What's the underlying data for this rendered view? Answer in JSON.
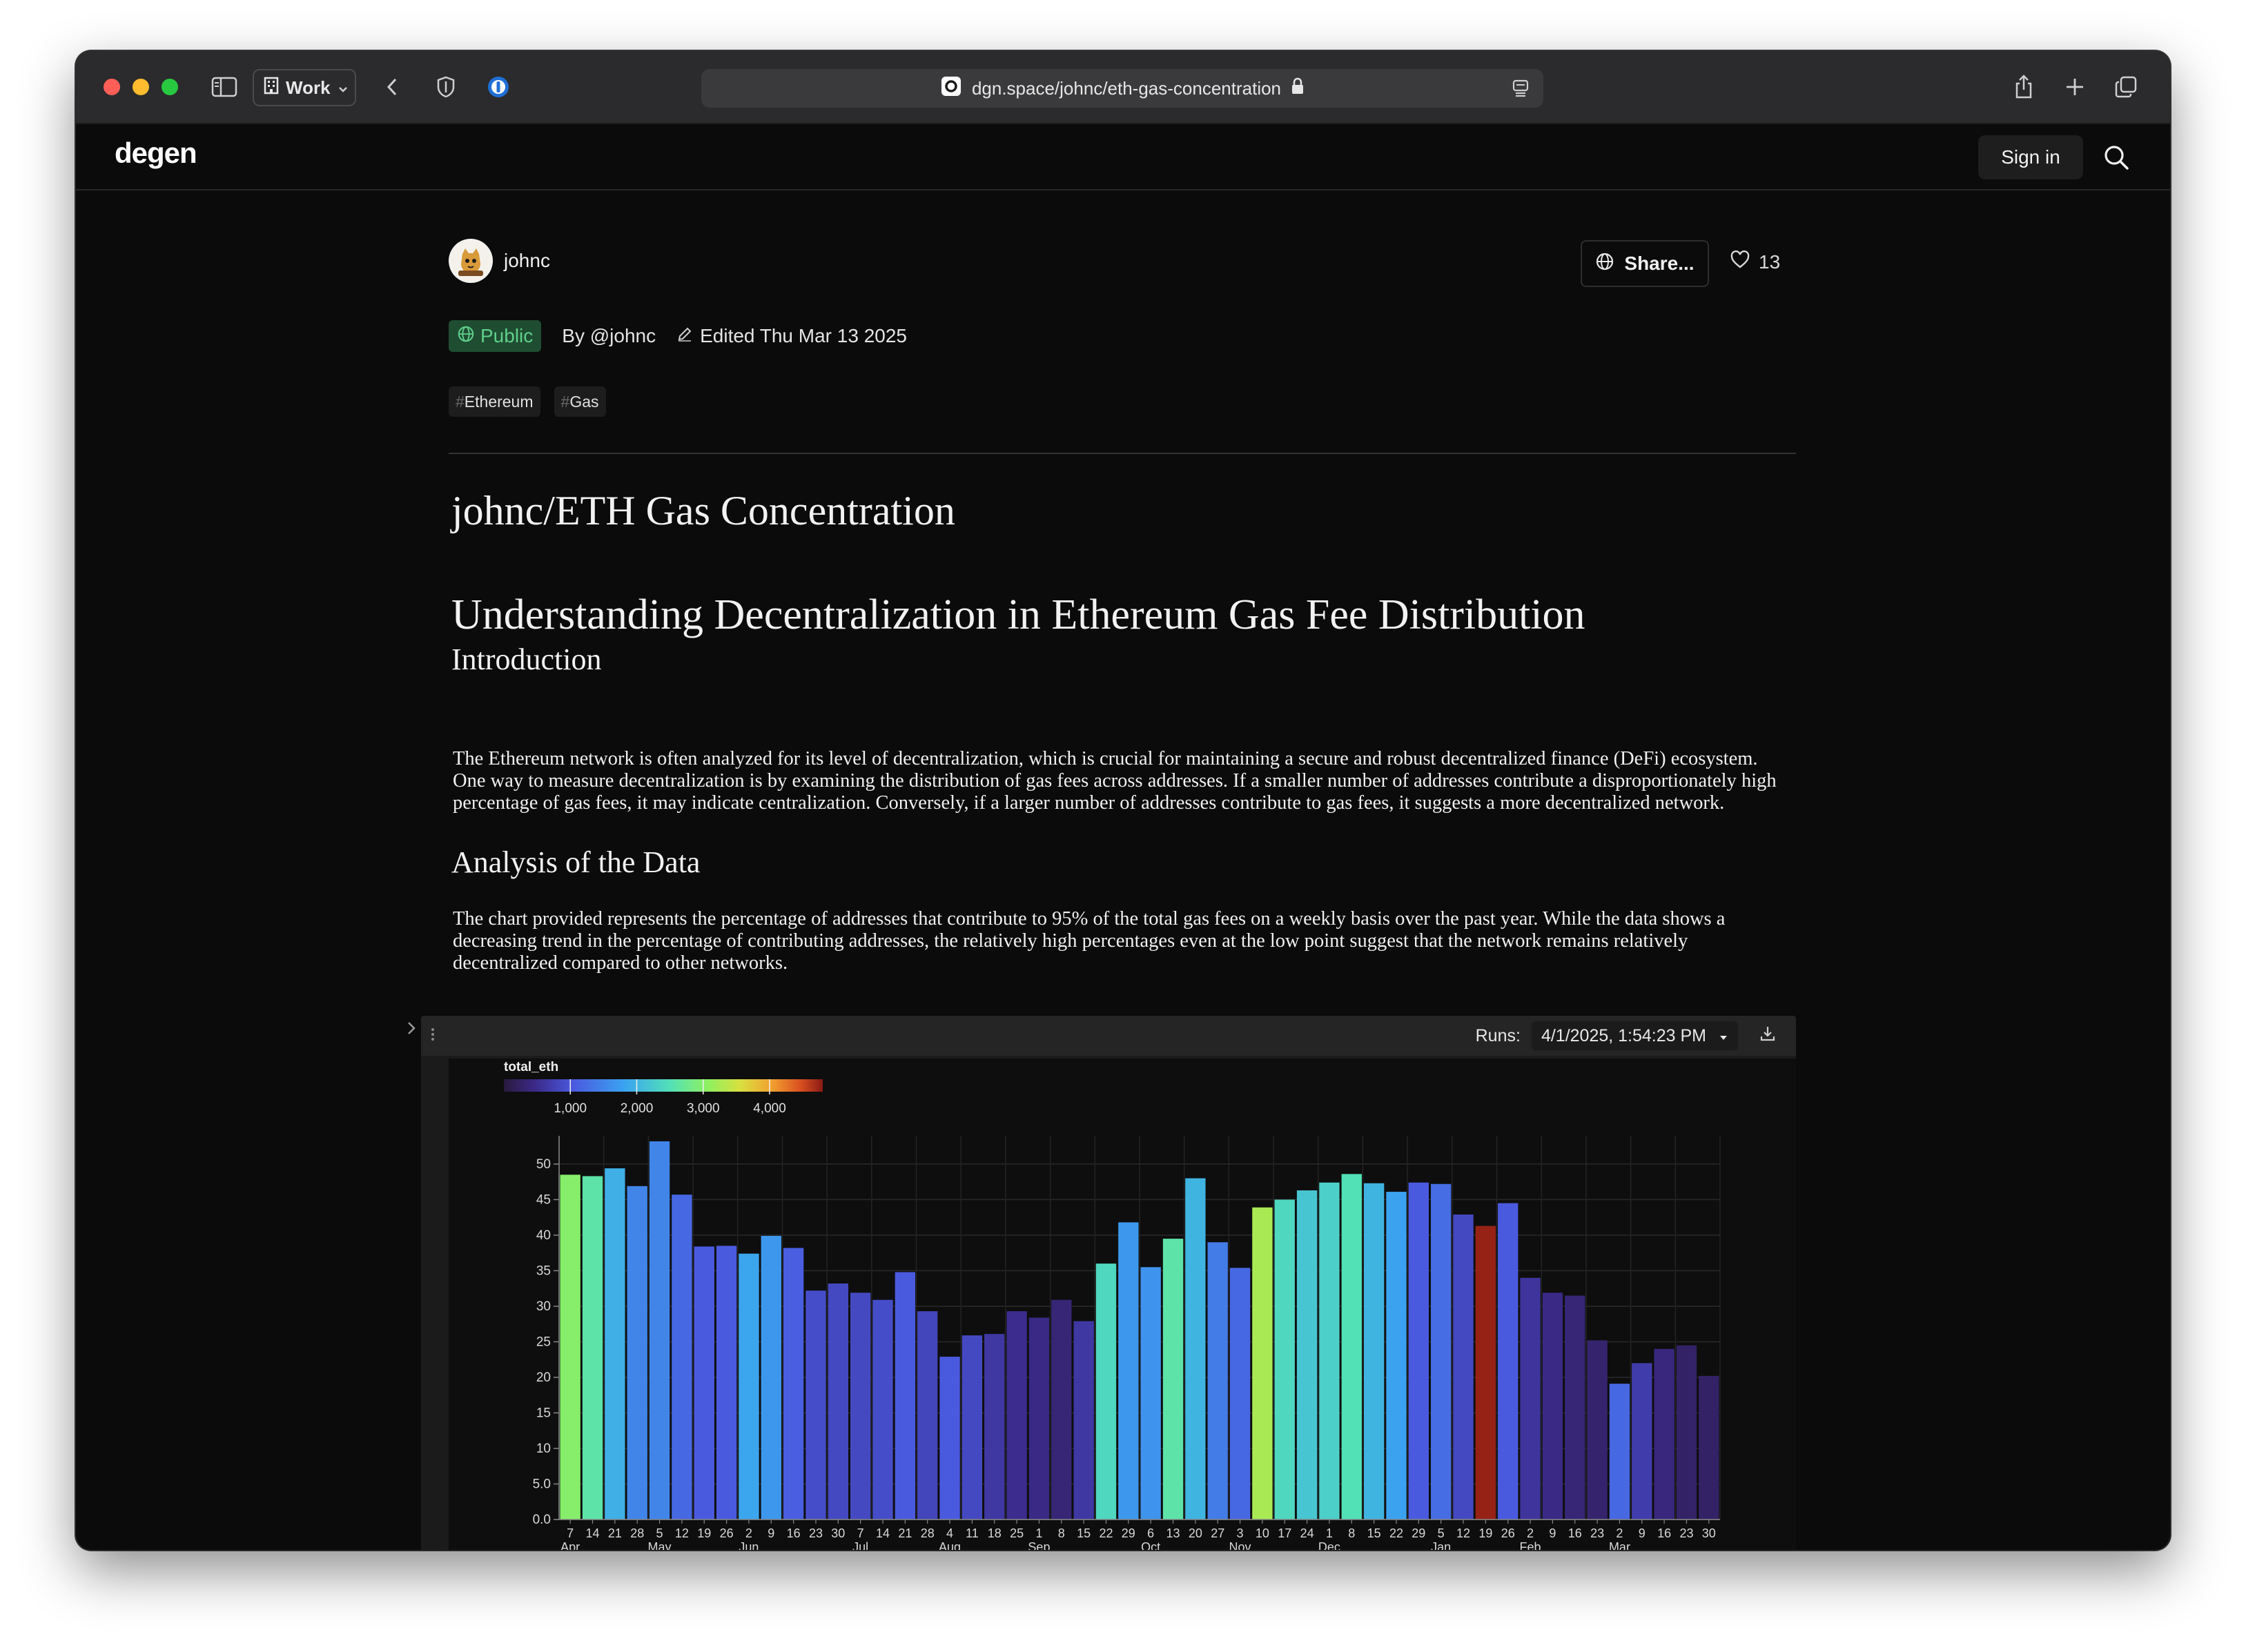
{
  "browser": {
    "tab_group": "Work",
    "url": "dgn.space/johnc/eth-gas-concentration"
  },
  "app": {
    "logo": "degen",
    "sign_in": "Sign in"
  },
  "post": {
    "author": "johnc",
    "share_label": "Share...",
    "likes": "13",
    "visibility": "Public",
    "by": "By @johnc",
    "edited": "Edited Thu Mar 13 2025",
    "tags": [
      {
        "hash": "#",
        "label": "Ethereum"
      },
      {
        "hash": "#",
        "label": "Gas"
      }
    ]
  },
  "doc": {
    "title": "johnc/ETH Gas Concentration",
    "h1": "Understanding Decentralization in Ethereum Gas Fee Distribution",
    "intro_heading": "Introduction",
    "intro_text": "The Ethereum network is often analyzed for its level of decentralization, which is crucial for maintaining a secure and robust decentralized finance (DeFi) ecosystem. One way to measure decentralization is by examining the distribution of gas fees across addresses. If a smaller number of addresses contribute a disproportionately high percentage of gas fees, it may indicate centralization. Conversely, if a larger number of addresses contribute to gas fees, it suggests a more decentralized network.",
    "analysis_heading": "Analysis of the Data",
    "analysis_text": "The chart provided represents the percentage of addresses that contribute to 95% of the total gas fees on a weekly basis over the past year. While the data shows a decreasing trend in the percentage of contributing addresses, the relatively high percentages even at the low point suggest that the network remains relatively decentralized compared to other networks."
  },
  "cell": {
    "runs_label": "Runs:",
    "run_selected": "4/1/2025, 1:54:23 PM"
  },
  "chart_data": {
    "type": "bar",
    "legend_title": "total_eth",
    "legend_ticks": [
      "1,000",
      "2,000",
      "3,000",
      "4,000"
    ],
    "color_range": [
      0,
      4800
    ],
    "ylim": [
      0,
      53
    ],
    "yticks": [
      "0.0",
      "5.0",
      "10",
      "15",
      "20",
      "25",
      "30",
      "35",
      "40",
      "45",
      "50"
    ],
    "grid": true,
    "categories": [
      "7",
      "14",
      "21",
      "28",
      "5",
      "12",
      "19",
      "26",
      "2",
      "9",
      "16",
      "23",
      "30",
      "7",
      "14",
      "21",
      "28",
      "4",
      "11",
      "18",
      "25",
      "1",
      "8",
      "15",
      "22",
      "29",
      "6",
      "13",
      "20",
      "27",
      "3",
      "10",
      "17",
      "24",
      "1",
      "8",
      "15",
      "22",
      "29",
      "5",
      "12",
      "19",
      "26",
      "2",
      "9",
      "16",
      "23",
      "2",
      "9",
      "16",
      "23",
      "30"
    ],
    "month_labels": [
      {
        "label": "Apr",
        "index": 0
      },
      {
        "label": "May",
        "index": 4
      },
      {
        "label": "Jun",
        "index": 8
      },
      {
        "label": "Jul",
        "index": 13
      },
      {
        "label": "Aug",
        "index": 17
      },
      {
        "label": "Sep",
        "index": 21
      },
      {
        "label": "Oct",
        "index": 26
      },
      {
        "label": "Nov",
        "index": 30
      },
      {
        "label": "Dec",
        "index": 34
      },
      {
        "label": "Jan",
        "index": 39
      },
      {
        "label": "Feb",
        "index": 43
      },
      {
        "label": "Mar",
        "index": 47
      }
    ],
    "values": [
      48.5,
      48.3,
      49.4,
      46.9,
      53.2,
      45.7,
      38.4,
      38.5,
      37.4,
      39.9,
      38.2,
      32.2,
      33.2,
      31.9,
      30.9,
      34.8,
      29.3,
      22.9,
      25.9,
      26.1,
      29.3,
      28.4,
      30.9,
      27.9,
      36.0,
      41.8,
      35.5,
      39.5,
      48.0,
      39.0,
      35.4,
      43.9,
      45.0,
      46.3,
      47.4,
      48.6,
      47.3,
      46.1,
      47.4,
      47.2,
      42.9,
      41.3,
      44.5,
      34.0,
      31.9,
      31.5,
      25.2,
      19.1,
      22.0,
      24.0,
      24.5,
      20.2
    ],
    "total_eth": [
      3000,
      2600,
      1950,
      1500,
      1500,
      1200,
      1050,
      1050,
      1850,
      1700,
      1100,
      900,
      850,
      850,
      900,
      1050,
      800,
      1050,
      850,
      650,
      500,
      450,
      350,
      650,
      2400,
      1700,
      1650,
      2600,
      2000,
      1400,
      1200,
      3250,
      2400,
      2200,
      2300,
      2500,
      2000,
      1800,
      1050,
      1250,
      850,
      4750,
      1050,
      600,
      450,
      350,
      300,
      1200,
      700,
      400,
      250,
      250
    ]
  }
}
